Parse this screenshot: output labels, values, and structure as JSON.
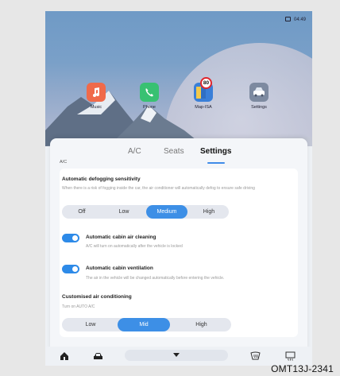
{
  "status": {
    "time": "04:49"
  },
  "apps": [
    {
      "label": "Music",
      "icon": "music-note-icon",
      "color": "#f06a4a"
    },
    {
      "label": "Phone",
      "icon": "phone-icon",
      "color": "#38c172"
    },
    {
      "label": "Map-ISA",
      "icon": "map-icon",
      "color": "#3a7fd8",
      "badge": "80"
    },
    {
      "label": "Settings",
      "icon": "car-settings-icon",
      "color": "#7d8aa0"
    }
  ],
  "tabs": [
    {
      "label": "A/C",
      "active": false
    },
    {
      "label": "Seats",
      "active": false
    },
    {
      "label": "Settings",
      "active": true
    }
  ],
  "section_label": "A/C",
  "defog": {
    "title": "Automatic defogging sensitivity",
    "description": "When there is a risk of fogging inside the car, the air conditioner will automatically defog to ensure safe driving",
    "options": [
      "Off",
      "Low",
      "Medium",
      "High"
    ],
    "selected": "Medium"
  },
  "cabin_cleaning": {
    "title": "Automatic cabin air cleaning",
    "description": "A/C will turn on automatically after the vehicle is locked",
    "enabled": true
  },
  "cabin_ventilation": {
    "title": "Automatic cabin ventilation",
    "description": "The air in the vehicle will be changed automatically before entering the vehicle.",
    "enabled": true
  },
  "custom_ac": {
    "title": "Customised air conditioning",
    "description": "Turn on AUTO A/C",
    "options": [
      "Low",
      "Mid",
      "High"
    ],
    "selected": "Mid"
  },
  "dock": {
    "icons": [
      "home-icon",
      "car-icon",
      "chevron-down-icon",
      "windshield-defrost-icon",
      "rear-defrost-icon"
    ]
  },
  "caption": "OMT13J-2341",
  "colors": {
    "accent": "#3d8fe6",
    "toggle_on": "#2d8ae8"
  }
}
